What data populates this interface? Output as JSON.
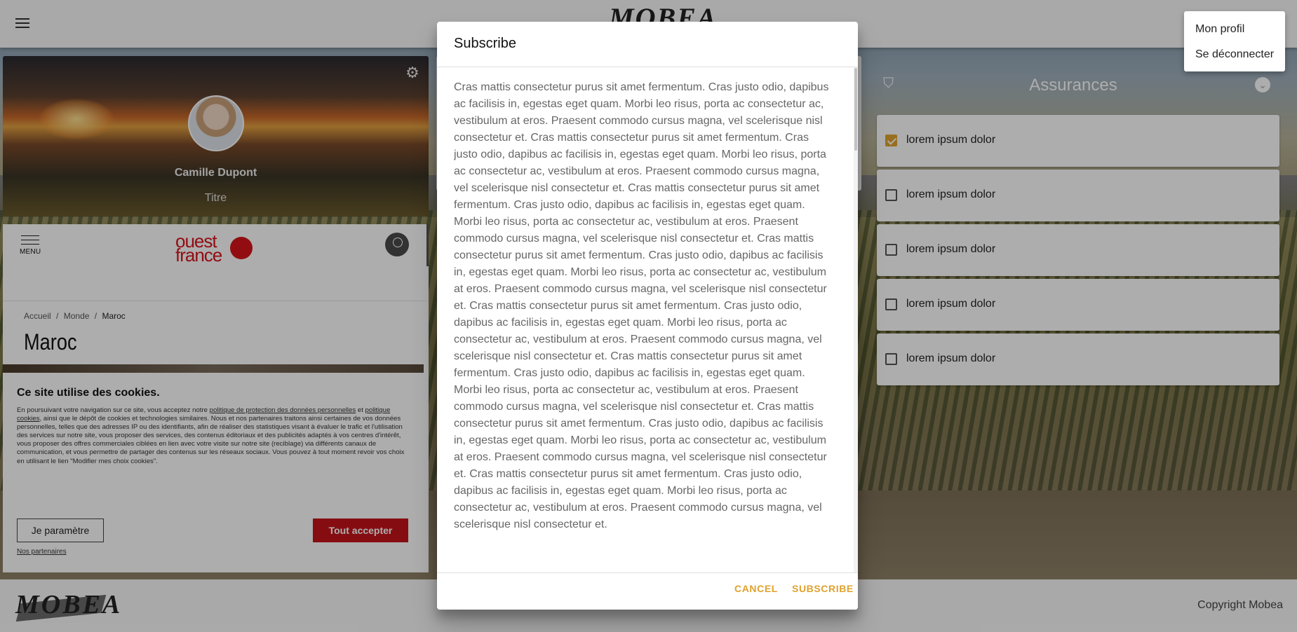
{
  "app": {
    "brand": "MOBEA",
    "copyright": "Copyright Mobea"
  },
  "user_menu": {
    "items": [
      "Mon profil",
      "Se déconnecter"
    ]
  },
  "profile": {
    "name": "Camille Dupont",
    "title": "Titre"
  },
  "news": {
    "menu_label": "MENU",
    "logo_line1": "ouest",
    "logo_line2": "france",
    "breadcrumb": [
      "Accueil",
      "/",
      "Monde",
      "/",
      "Maroc"
    ],
    "page_title": "Maroc"
  },
  "cookie": {
    "heading": "Ce site utilise des cookies.",
    "text_1": "En poursuivant votre navigation sur ce site, vous acceptez notre ",
    "link_1": "politique de protection des données personnelles",
    "text_2": " et ",
    "link_2": "politique cookies",
    "text_3": ", ainsi que le dépôt de cookies et technologies similaires. Nous et nos partenaires traitons ainsi certaines de vos données personnelles, telles que des adresses IP ou des identifiants, afin de réaliser des statistiques visant à évaluer le trafic et l'utilisation des services sur notre site, vous proposer des services, des contenus éditoriaux et des publicités adaptés à vos centres d'intérêt, vous proposer des offres commerciales ciblées en lien avec votre visite sur notre site (reciblage) via différents canaux de communication, et vous permettre de partager des contenus sur les réseaux sociaux. Vous pouvez à tout moment revoir vos choix en utilisant le lien \"Modifier mes choix cookies\".",
    "btn_param": "Je paramètre",
    "btn_accept": "Tout accepter",
    "partners": "Nos partenaires"
  },
  "insurances": {
    "title": "Assurances",
    "items": [
      {
        "label": "lorem ipsum dolor",
        "checked": true
      },
      {
        "label": "lorem ipsum dolor",
        "checked": false
      },
      {
        "label": "lorem ipsum dolor",
        "checked": false
      },
      {
        "label": "lorem ipsum dolor",
        "checked": false
      },
      {
        "label": "lorem ipsum dolor",
        "checked": false
      }
    ]
  },
  "dialog": {
    "title": "Subscribe",
    "body": "Cras mattis consectetur purus sit amet fermentum. Cras justo odio, dapibus ac facilisis in, egestas eget quam. Morbi leo risus, porta ac consectetur ac, vestibulum at eros. Praesent commodo cursus magna, vel scelerisque nisl consectetur et. Cras mattis consectetur purus sit amet fermentum. Cras justo odio, dapibus ac facilisis in, egestas eget quam. Morbi leo risus, porta ac consectetur ac, vestibulum at eros. Praesent commodo cursus magna, vel scelerisque nisl consectetur et. Cras mattis consectetur purus sit amet fermentum. Cras justo odio, dapibus ac facilisis in, egestas eget quam. Morbi leo risus, porta ac consectetur ac, vestibulum at eros. Praesent commodo cursus magna, vel scelerisque nisl consectetur et. Cras mattis consectetur purus sit amet fermentum. Cras justo odio, dapibus ac facilisis in, egestas eget quam. Morbi leo risus, porta ac consectetur ac, vestibulum at eros. Praesent commodo cursus magna, vel scelerisque nisl consectetur et. Cras mattis consectetur purus sit amet fermentum. Cras justo odio, dapibus ac facilisis in, egestas eget quam. Morbi leo risus, porta ac consectetur ac, vestibulum at eros. Praesent commodo cursus magna, vel scelerisque nisl consectetur et. Cras mattis consectetur purus sit amet fermentum. Cras justo odio, dapibus ac facilisis in, egestas eget quam. Morbi leo risus, porta ac consectetur ac, vestibulum at eros. Praesent commodo cursus magna, vel scelerisque nisl consectetur et. Cras mattis consectetur purus sit amet fermentum. Cras justo odio, dapibus ac facilisis in, egestas eget quam. Morbi leo risus, porta ac consectetur ac, vestibulum at eros. Praesent commodo cursus magna, vel scelerisque nisl consectetur et. Cras mattis consectetur purus sit amet fermentum. Cras justo odio, dapibus ac facilisis in, egestas eget quam. Morbi leo risus, porta ac consectetur ac, vestibulum at eros. Praesent commodo cursus magna, vel scelerisque nisl consectetur et.",
    "cancel": "CANCEL",
    "subscribe": "SUBSCRIBE"
  },
  "colors": {
    "accent": "#e0a22e",
    "news_red": "#c4141a"
  }
}
